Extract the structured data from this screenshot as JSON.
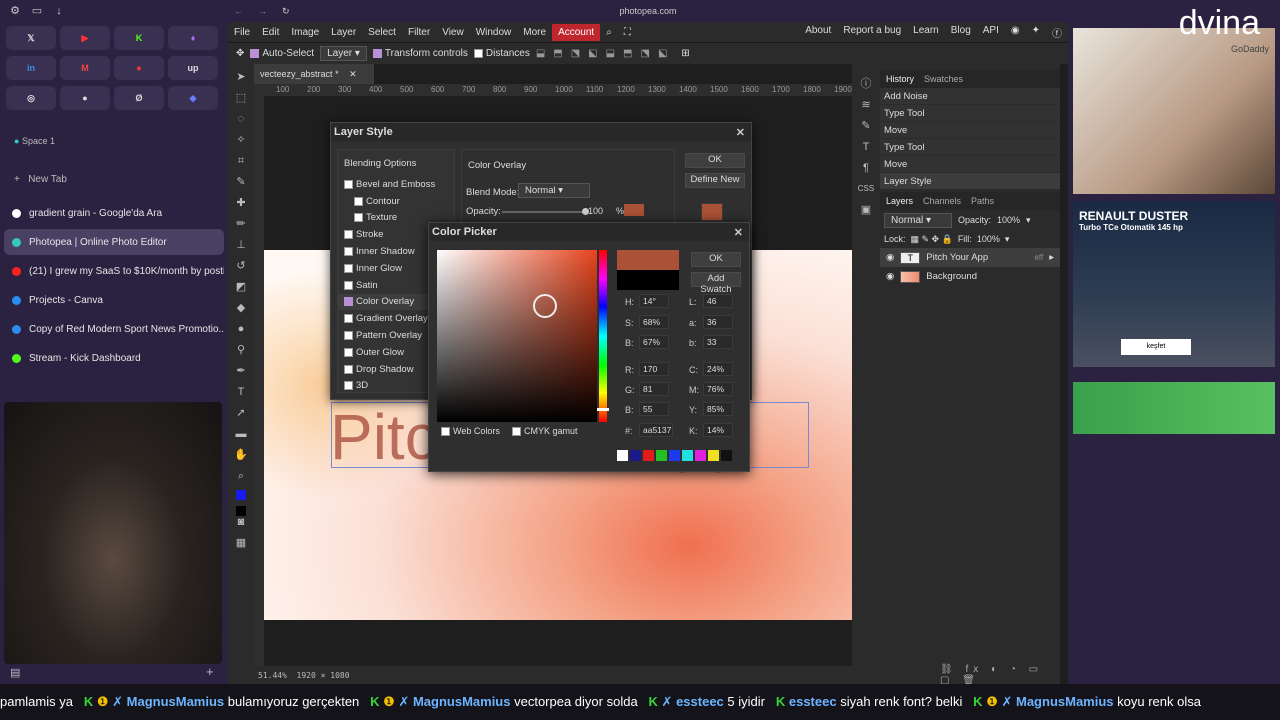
{
  "browser": {
    "url": "photopea.com",
    "space": "Space 1",
    "new_tab": "New Tab",
    "tabs": [
      {
        "title": "gradient grain - Google'da Ara",
        "color": "#ffffff"
      },
      {
        "title": "Photopea | Online Photo Editor",
        "color": "#34c6b8"
      },
      {
        "title": "(21) I grew my SaaS to $10K/month by posti...",
        "color": "#ff2020"
      },
      {
        "title": "Projects - Canva",
        "color": "#2b8cf0"
      },
      {
        "title": "Copy of Red Modern Sport News Promotio...",
        "color": "#2b8cf0"
      },
      {
        "title": "Stream - Kick Dashboard",
        "color": "#53fc18"
      }
    ],
    "pins": [
      "𝕏",
      "▶",
      "K",
      "♦",
      "in",
      "M",
      "●",
      "up",
      "◎",
      "●",
      "Ø",
      "◆"
    ]
  },
  "menu": {
    "items": [
      "File",
      "Edit",
      "Image",
      "Layer",
      "Select",
      "Filter",
      "View",
      "Window",
      "More"
    ],
    "account": "Account",
    "right": [
      "About",
      "Report a bug",
      "Learn",
      "Blog",
      "API"
    ]
  },
  "options": {
    "auto_select": "Auto-Select",
    "layer": "Layer",
    "transform": "Transform controls",
    "distances": "Distances"
  },
  "document": {
    "tab": "vecteezy_abstract",
    "modified": "*",
    "status_zoom": "51.44%",
    "status_size": "1920 × 1080",
    "text": "Pitch Your App"
  },
  "ruler": [
    "100",
    "200",
    "300",
    "400",
    "500",
    "600",
    "700",
    "800",
    "900",
    "1000",
    "1100",
    "1200",
    "1300",
    "1400",
    "1500",
    "1600",
    "1700",
    "1800",
    "1900"
  ],
  "history": {
    "tabs": [
      "History",
      "Swatches"
    ],
    "items": [
      "Add Noise",
      "Type Tool",
      "Move",
      "Type Tool",
      "Move",
      "Layer Style"
    ]
  },
  "layers": {
    "tabs": [
      "Layers",
      "Channels",
      "Paths"
    ],
    "blend": "Normal",
    "opacity_label": "Opacity:",
    "opacity": "100%",
    "lock_label": "Lock:",
    "fill_label": "Fill:",
    "fill": "100%",
    "items": [
      {
        "name": "Pitch Your App",
        "fx": "eff"
      },
      {
        "name": "Background",
        "fx": ""
      }
    ]
  },
  "layer_style": {
    "title": "Layer Style",
    "blending_options": "Blending Options",
    "effects": [
      {
        "label": "Bevel and Emboss",
        "checked": false,
        "indent": false
      },
      {
        "label": "Contour",
        "checked": false,
        "indent": true
      },
      {
        "label": "Texture",
        "checked": false,
        "indent": true
      },
      {
        "label": "Stroke",
        "checked": false,
        "indent": false
      },
      {
        "label": "Inner Shadow",
        "checked": false,
        "indent": false
      },
      {
        "label": "Inner Glow",
        "checked": false,
        "indent": false
      },
      {
        "label": "Satin",
        "checked": false,
        "indent": false
      },
      {
        "label": "Color Overlay",
        "checked": true,
        "indent": false
      },
      {
        "label": "Gradient Overlay",
        "checked": false,
        "indent": false
      },
      {
        "label": "Pattern Overlay",
        "checked": false,
        "indent": false
      },
      {
        "label": "Outer Glow",
        "checked": false,
        "indent": false
      },
      {
        "label": "Drop Shadow",
        "checked": false,
        "indent": false
      },
      {
        "label": "3D",
        "checked": false,
        "indent": false
      }
    ],
    "section": "Color Overlay",
    "blend_label": "Blend Mode:",
    "blend": "Normal",
    "opacity_label": "Opacity:",
    "opacity": "100",
    "pct": "%",
    "ok": "OK",
    "define_new": "Define New",
    "overlay_color": "#aa5137"
  },
  "color_picker": {
    "title": "Color Picker",
    "ok": "OK",
    "add_swatch": "Add Swatch",
    "new_color": "#aa5137",
    "old_color": "#000000",
    "fields": {
      "H": "14°",
      "S": "68%",
      "B": "67%",
      "R": "170",
      "G": "81",
      "Bv": "55",
      "hex": "aa5137",
      "L": "46",
      "a": "36",
      "b": "33",
      "C": "24%",
      "M": "76%",
      "Y": "85%",
      "K": "14%"
    },
    "web_colors": "Web Colors",
    "cmyk_gamut": "CMYK gamut",
    "swatches": [
      "#ffffff",
      "#1a1a8a",
      "#e21b1b",
      "#22c022",
      "#1a3aee",
      "#22e0e0",
      "#e020e0",
      "#f0e020",
      "#111111"
    ]
  },
  "ads": {
    "top_brand": "GoDaddy",
    "renault_title": "RENAULT DUSTER",
    "renault_sub": "Turbo TCe Otomatik 145 hp",
    "renault_btn": "keşfet",
    "logo": "dvina"
  },
  "chat": [
    {
      "u": "",
      "m": "pamlamis ya"
    },
    {
      "u": "MagnusMamius",
      "m": "bulamıyoruz gerçekten"
    },
    {
      "u": "MagnusMamius",
      "m": "vectorpea diyor solda"
    },
    {
      "u": "essteec",
      "m": "5 iyidir"
    },
    {
      "u": "essteec",
      "m": "siyah renk font? belki"
    },
    {
      "u": "MagnusMamius",
      "m": "koyu renk olsa"
    }
  ]
}
